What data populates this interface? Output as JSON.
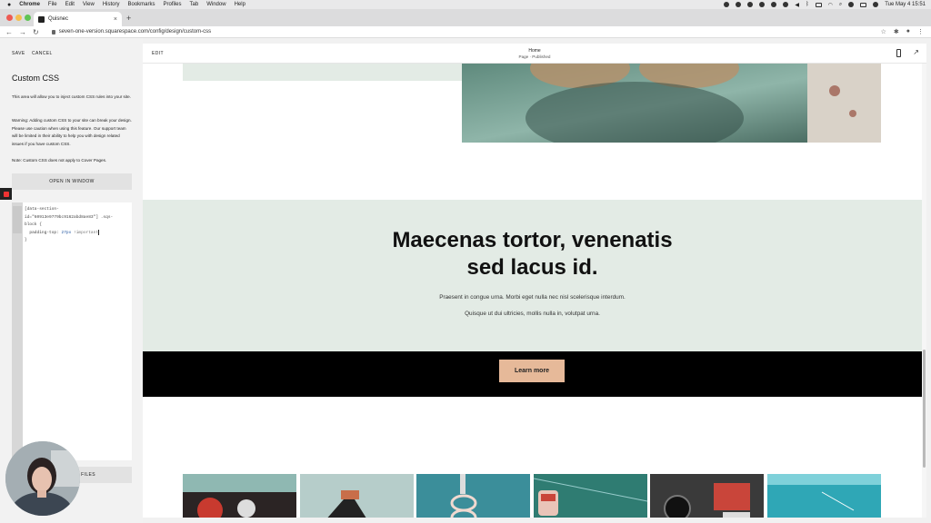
{
  "menubar": {
    "app": "Chrome",
    "items": [
      "File",
      "Edit",
      "View",
      "History",
      "Bookmarks",
      "Profiles",
      "Tab",
      "Window",
      "Help"
    ],
    "clock": "Tue May 4  15:51"
  },
  "browser": {
    "tab_title": "Quisnec",
    "url": "seven-one-version.squarespace.com/config/design/custom-css"
  },
  "left_panel": {
    "save": "SAVE",
    "cancel": "CANCEL",
    "title": "Custom CSS",
    "intro": "This area will allow you to inject custom CSS rules into your site.",
    "warning": "Warning: Adding custom CSS to your site can break your design. Please use caution when using this feature. Our support team will be limited in their ability to help you with design related issues if you have custom CSS.",
    "note": "Note: Custom CSS does not apply to Cover Pages.",
    "open_window": "OPEN IN WINDOW",
    "code": {
      "line1": "[data-section-",
      "line2": "id=\"60913e9779bc9162abd8ae83\"] .sqs-",
      "line3": "block {",
      "line4_prop": "  padding-top: ",
      "line4_num": "27px",
      "line4_imp": " !important",
      "line5": "}"
    },
    "manage_files": "OM FILES"
  },
  "preview": {
    "edit": "EDIT",
    "page_name": "Home",
    "page_status": "Page · Published"
  },
  "site": {
    "heading_line1": "Maecenas tortor, venenatis",
    "heading_line2": "sed lacus id.",
    "sub1": "Praesent in congue urna. Morbi eget nulla nec nisl scelerisque interdum.",
    "sub2": "Quisque ut dui ultricies, mollis nulla in, volutpat urna.",
    "cta": "Learn more"
  },
  "colors": {
    "mint": "#e3ebe5",
    "cta_band": "#000000",
    "cta_button": "#e6b999"
  }
}
